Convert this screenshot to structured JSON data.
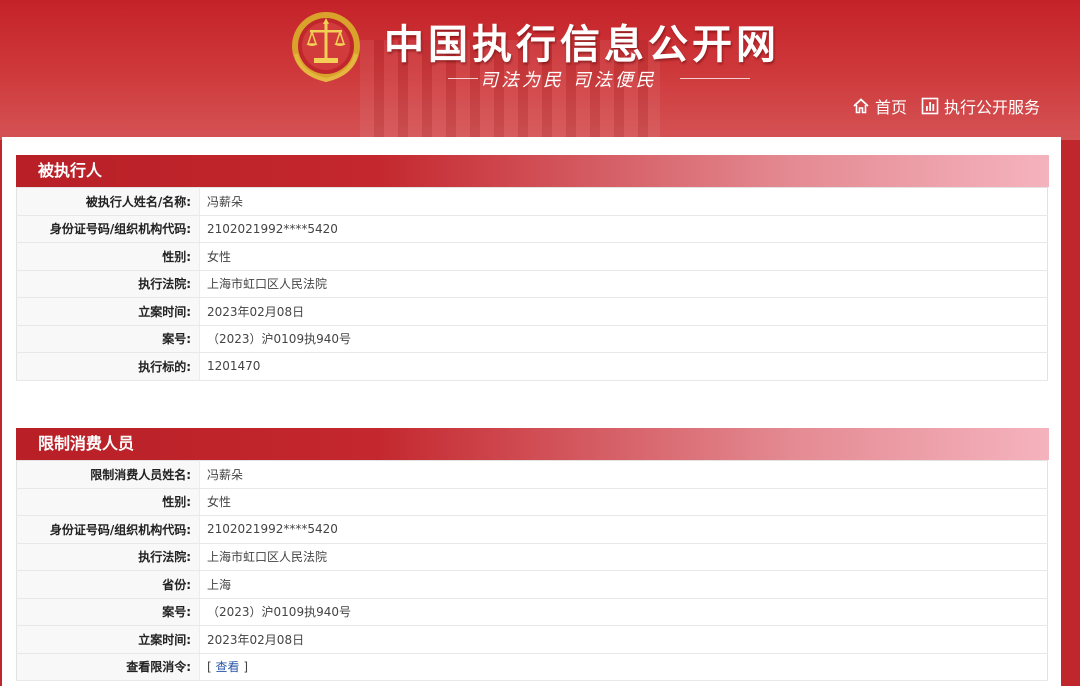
{
  "site": {
    "title": "中国执行信息公开网",
    "slogan": "司法为民   司法便民"
  },
  "nav": [
    {
      "label": "首页",
      "icon": "home-icon"
    },
    {
      "label": "执行公开服务",
      "icon": "chart-icon"
    }
  ],
  "colors": {
    "brand_red": "#c0272d",
    "link_blue": "#2a57a8"
  },
  "sections": [
    {
      "title": "被执行人",
      "rows": [
        {
          "label": "被执行人姓名/名称:",
          "value": "冯薪朵"
        },
        {
          "label": "身份证号码/组织机构代码:",
          "value": "2102021992****5420"
        },
        {
          "label": "性别:",
          "value": "女性"
        },
        {
          "label": "执行法院:",
          "value": "上海市虹口区人民法院"
        },
        {
          "label": "立案时间:",
          "value": "2023年02月08日"
        },
        {
          "label": "案号:",
          "value": "（2023）沪0109执940号"
        },
        {
          "label": "执行标的:",
          "value": "1201470"
        }
      ]
    },
    {
      "title": "限制消费人员",
      "rows": [
        {
          "label": "限制消费人员姓名:",
          "value": "冯薪朵"
        },
        {
          "label": "性别:",
          "value": "女性"
        },
        {
          "label": "身份证号码/组织机构代码:",
          "value": "2102021992****5420"
        },
        {
          "label": "执行法院:",
          "value": "上海市虹口区人民法院"
        },
        {
          "label": "省份:",
          "value": "上海"
        },
        {
          "label": "案号:",
          "value": "（2023）沪0109执940号"
        },
        {
          "label": "立案时间:",
          "value": "2023年02月08日"
        },
        {
          "label": "查看限消令:",
          "value": "",
          "link": "查看",
          "bracket_open": "[",
          "bracket_close": "]"
        }
      ]
    }
  ]
}
